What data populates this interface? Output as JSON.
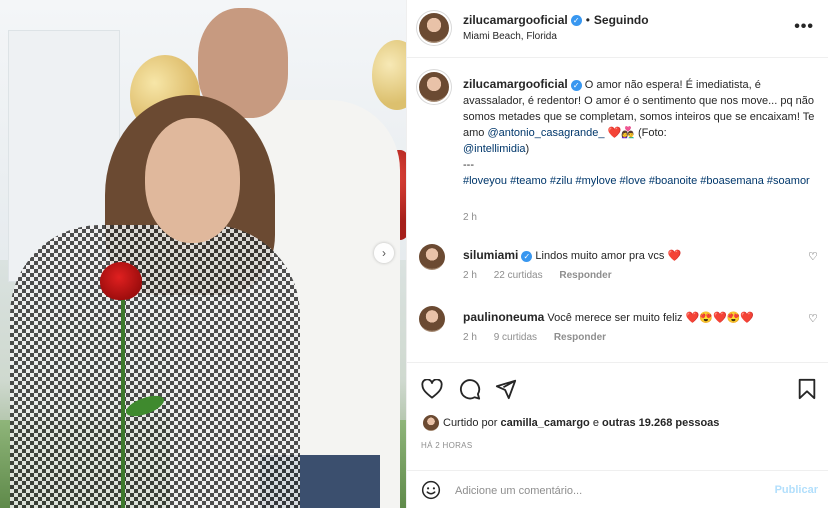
{
  "header": {
    "username": "zilucamargooficial",
    "separator": "•",
    "follow_status": "Seguindo",
    "location": "Miami Beach, Florida",
    "more_label": "•••"
  },
  "caption": {
    "username": "zilucamargooficial",
    "text_before_mention": "O amor não espera! É imediatista, é avassalador, é redentor! O amor é o sentimento que nos move... pq não somos metades que se completam, somos inteiros que se encaixam! Te amo ",
    "mention1": "@antonio_casagrande_",
    "text_after_mention": " ❤️👩‍❤️‍👨 (Foto: ",
    "mention2": "@intellimidia",
    "text_close": ")",
    "separator": "---",
    "hashtags": "#loveyou #teamo #zilu #mylove #love #boanoite #boasemana #soamor",
    "time": "2 h"
  },
  "comments": [
    {
      "username": "silumiami",
      "verified": true,
      "text": "Lindos muito amor pra vcs ❤️",
      "time": "2 h",
      "likes": "22 curtidas",
      "reply": "Responder"
    },
    {
      "username": "paulinoneuma",
      "verified": false,
      "text": "Você merece ser muito feliz ❤️😍❤️😍❤️",
      "time": "2 h",
      "likes": "9 curtidas",
      "reply": "Responder"
    }
  ],
  "likes": {
    "prefix": "Curtido por ",
    "user": "camilla_camargo",
    "middle": " e ",
    "others": "outras 19.268 pessoas"
  },
  "time_ago": "HÁ 2 HORAS",
  "add_comment": {
    "placeholder": "Adicione um comentário...",
    "publish_label": "Publicar"
  },
  "icons": {
    "verified": "✓",
    "heart_small": "♡",
    "next": "›",
    "emoji": "☺"
  },
  "colors": {
    "verified": "#3897f0",
    "link": "#00376b",
    "publish_disabled": "#b2dffc",
    "muted": "#8e8e8e"
  }
}
